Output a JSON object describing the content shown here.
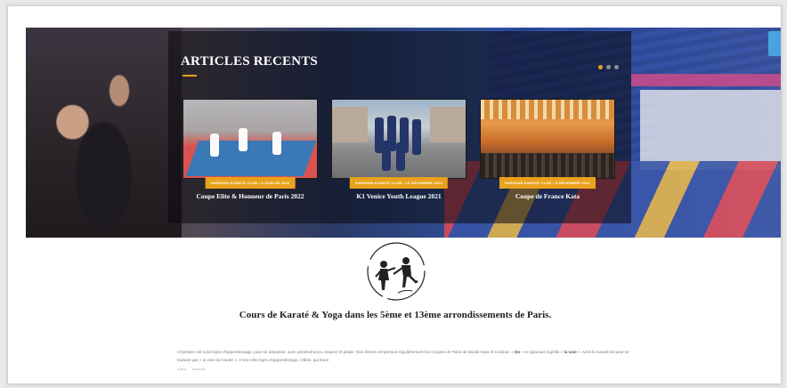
{
  "section": {
    "title": "ARTICLES RECENTS",
    "slider": {
      "dot_count": 3,
      "active_dot": 0
    }
  },
  "articles": [
    {
      "badge": "PARISIAN KARATE CLUB  •  4 JUIN DE 2022",
      "title": "Coupe Elite & Honneur de Paris 2022",
      "image": "karate-competition-photo"
    },
    {
      "badge": "PARISIAN KARATE CLUB  •  12 DÉCEMBRE 2021",
      "title": "K1 Venice Youth League 2021",
      "image": "team-in-venice-photo"
    },
    {
      "badge": "PARISIAN KARATE CLUB  •  5 DÉCEMBRE 2021",
      "title": "Coupe de France Kata",
      "image": "arena-photo"
    }
  ],
  "main": {
    "heading": "Cours de Karaté & Yoga dans les 5ème et 13ème arrondissements de Paris.",
    "paragraph_start": "Choisisse est notre ligne d'apprentissage, pour se dépasser, avec persévérance, respect et plaisir. Nos élèves remportent régulièrement les Coupes de Paris de karaté Kata et Combat. « ",
    "do_word": "Do",
    "paragraph_mid": " » en japonais signifie « ",
    "voie_word": "la voie",
    "paragraph_end": " ». Ainsi le Karaté-do peut se traduire par « la voie du Karaté ». C'est cette ligne d'apprentissage, infinie, qui trace",
    "paragraph_cut": "notre ... d'esprit."
  },
  "colors": {
    "accent": "#e8a21c",
    "overlay": "#0a0a0e",
    "heading": "#1e1e1e"
  },
  "icons": {
    "logo": "karate-fighters-logo"
  }
}
